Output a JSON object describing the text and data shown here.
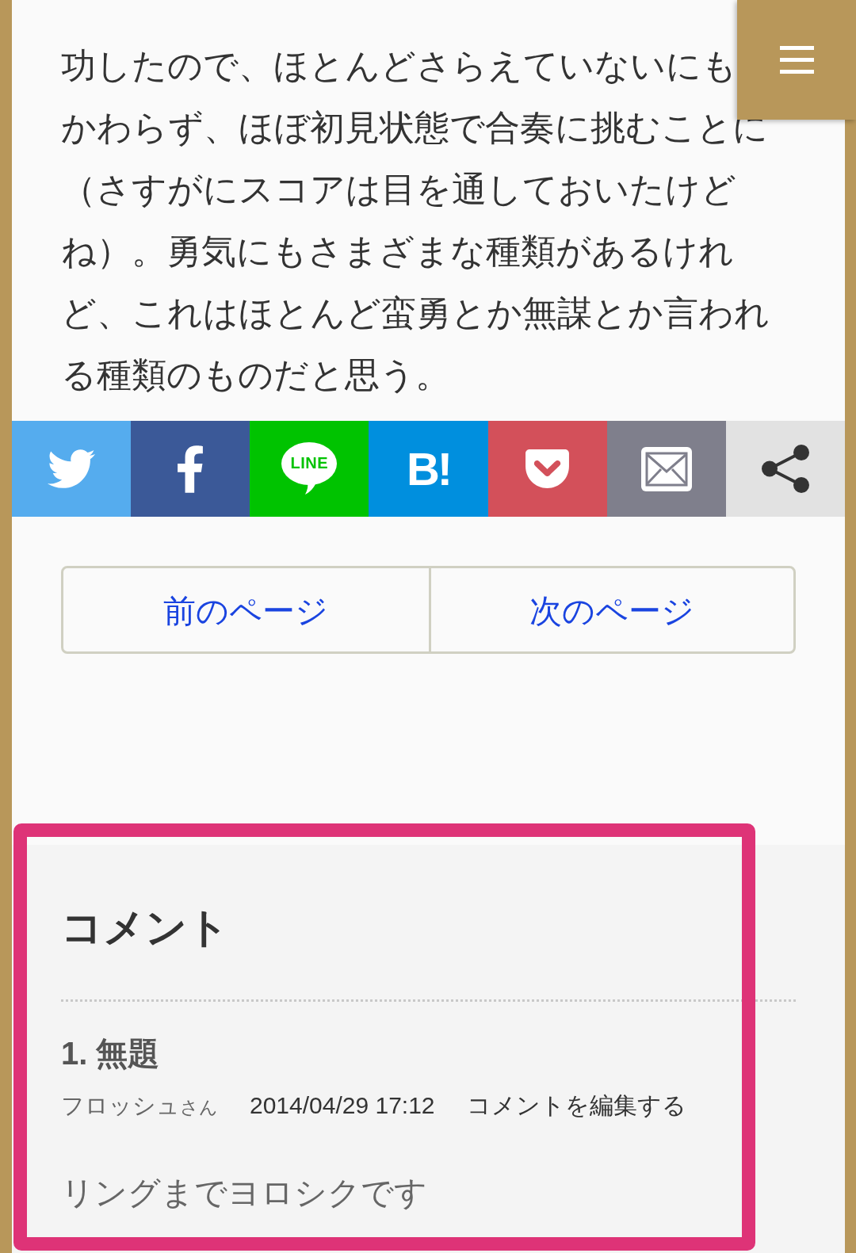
{
  "article": {
    "lines": [
      "功したので、ほとんどさらえていないにも",
      "かわらず、ほぼ初見状態で合奏に挑むことに",
      "（さすがにスコアは目を通しておいたけど",
      "ね）。勇気にもさまざまな種類があるけれ",
      "ど、これはほとんど蛮勇とか無謀とか言われ",
      "る種類のものだと思う。"
    ]
  },
  "share_buttons": [
    {
      "kind": "twitter"
    },
    {
      "kind": "facebook"
    },
    {
      "kind": "line",
      "label": "LINE"
    },
    {
      "kind": "hatena",
      "label": "B!"
    },
    {
      "kind": "pocket"
    },
    {
      "kind": "mail"
    },
    {
      "kind": "share"
    }
  ],
  "page_nav": {
    "previous": "前のページ",
    "next": "次のページ"
  },
  "comments": {
    "title": "コメント",
    "items": [
      {
        "title": "1. 無題",
        "author": "フロッシュ",
        "honorific": "さん",
        "date": "2014/04/29 17:12",
        "edit_link": "コメントを編集する",
        "body": "リングまでヨロシクです"
      }
    ]
  },
  "highlight_frame": true
}
